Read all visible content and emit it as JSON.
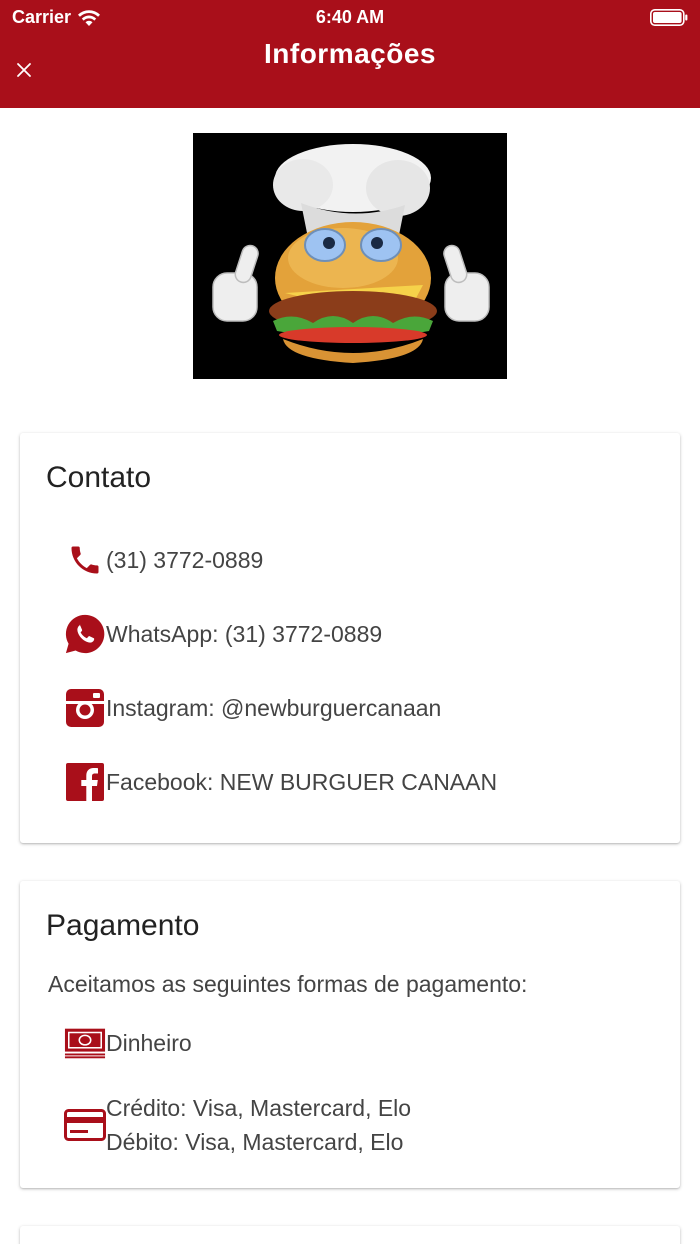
{
  "status": {
    "carrier": "Carrier",
    "time": "6:40 AM"
  },
  "header": {
    "title": "Informações"
  },
  "contact": {
    "title": "Contato",
    "phone": "(31) 3772-0889",
    "whatsapp": "WhatsApp: (31) 3772-0889",
    "instagram": "Instagram: @newburguercanaan",
    "facebook": "Facebook: NEW BURGUER CANAAN"
  },
  "payment": {
    "title": "Pagamento",
    "intro": "Aceitamos as seguintes formas de pagamento:",
    "cash": "Dinheiro",
    "credit": "Crédito: Visa, Mastercard, Elo",
    "debit": "Débito: Visa, Mastercard, Elo"
  },
  "colors": {
    "brand": "#a90f1a",
    "icon": "#a90f1a"
  },
  "icons": [
    "wifi-icon",
    "battery-icon",
    "close-icon",
    "phone-icon",
    "whatsapp-icon",
    "instagram-icon",
    "facebook-icon",
    "cash-icon",
    "credit-card-icon"
  ]
}
